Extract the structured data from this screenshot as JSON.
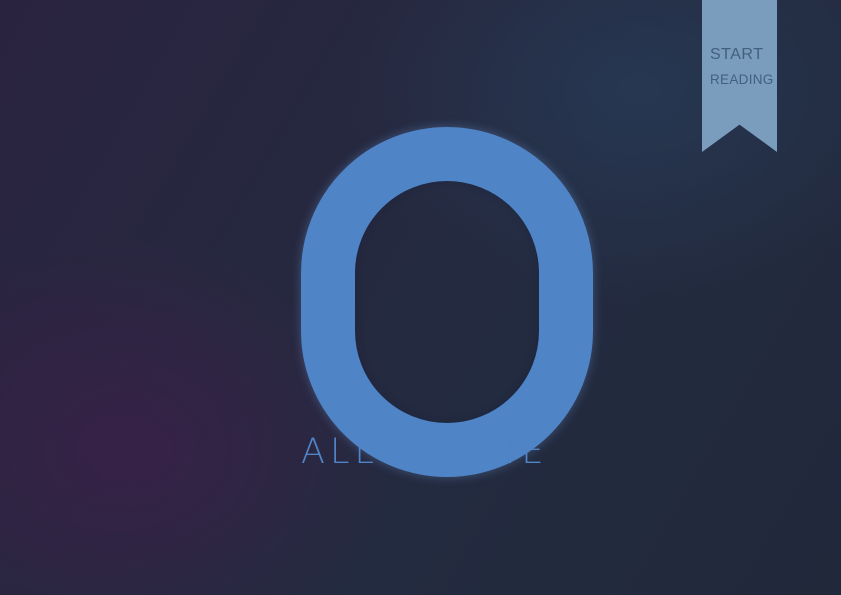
{
  "cover": {
    "logo_letter": "O",
    "tagline": "ALL IN ONE",
    "accent_color": "#4f84c7",
    "background_color": "#24293d"
  },
  "bookmark": {
    "line1": "START",
    "line2": "READING",
    "color": "#7a9cbd",
    "text_color": "#43607e"
  }
}
